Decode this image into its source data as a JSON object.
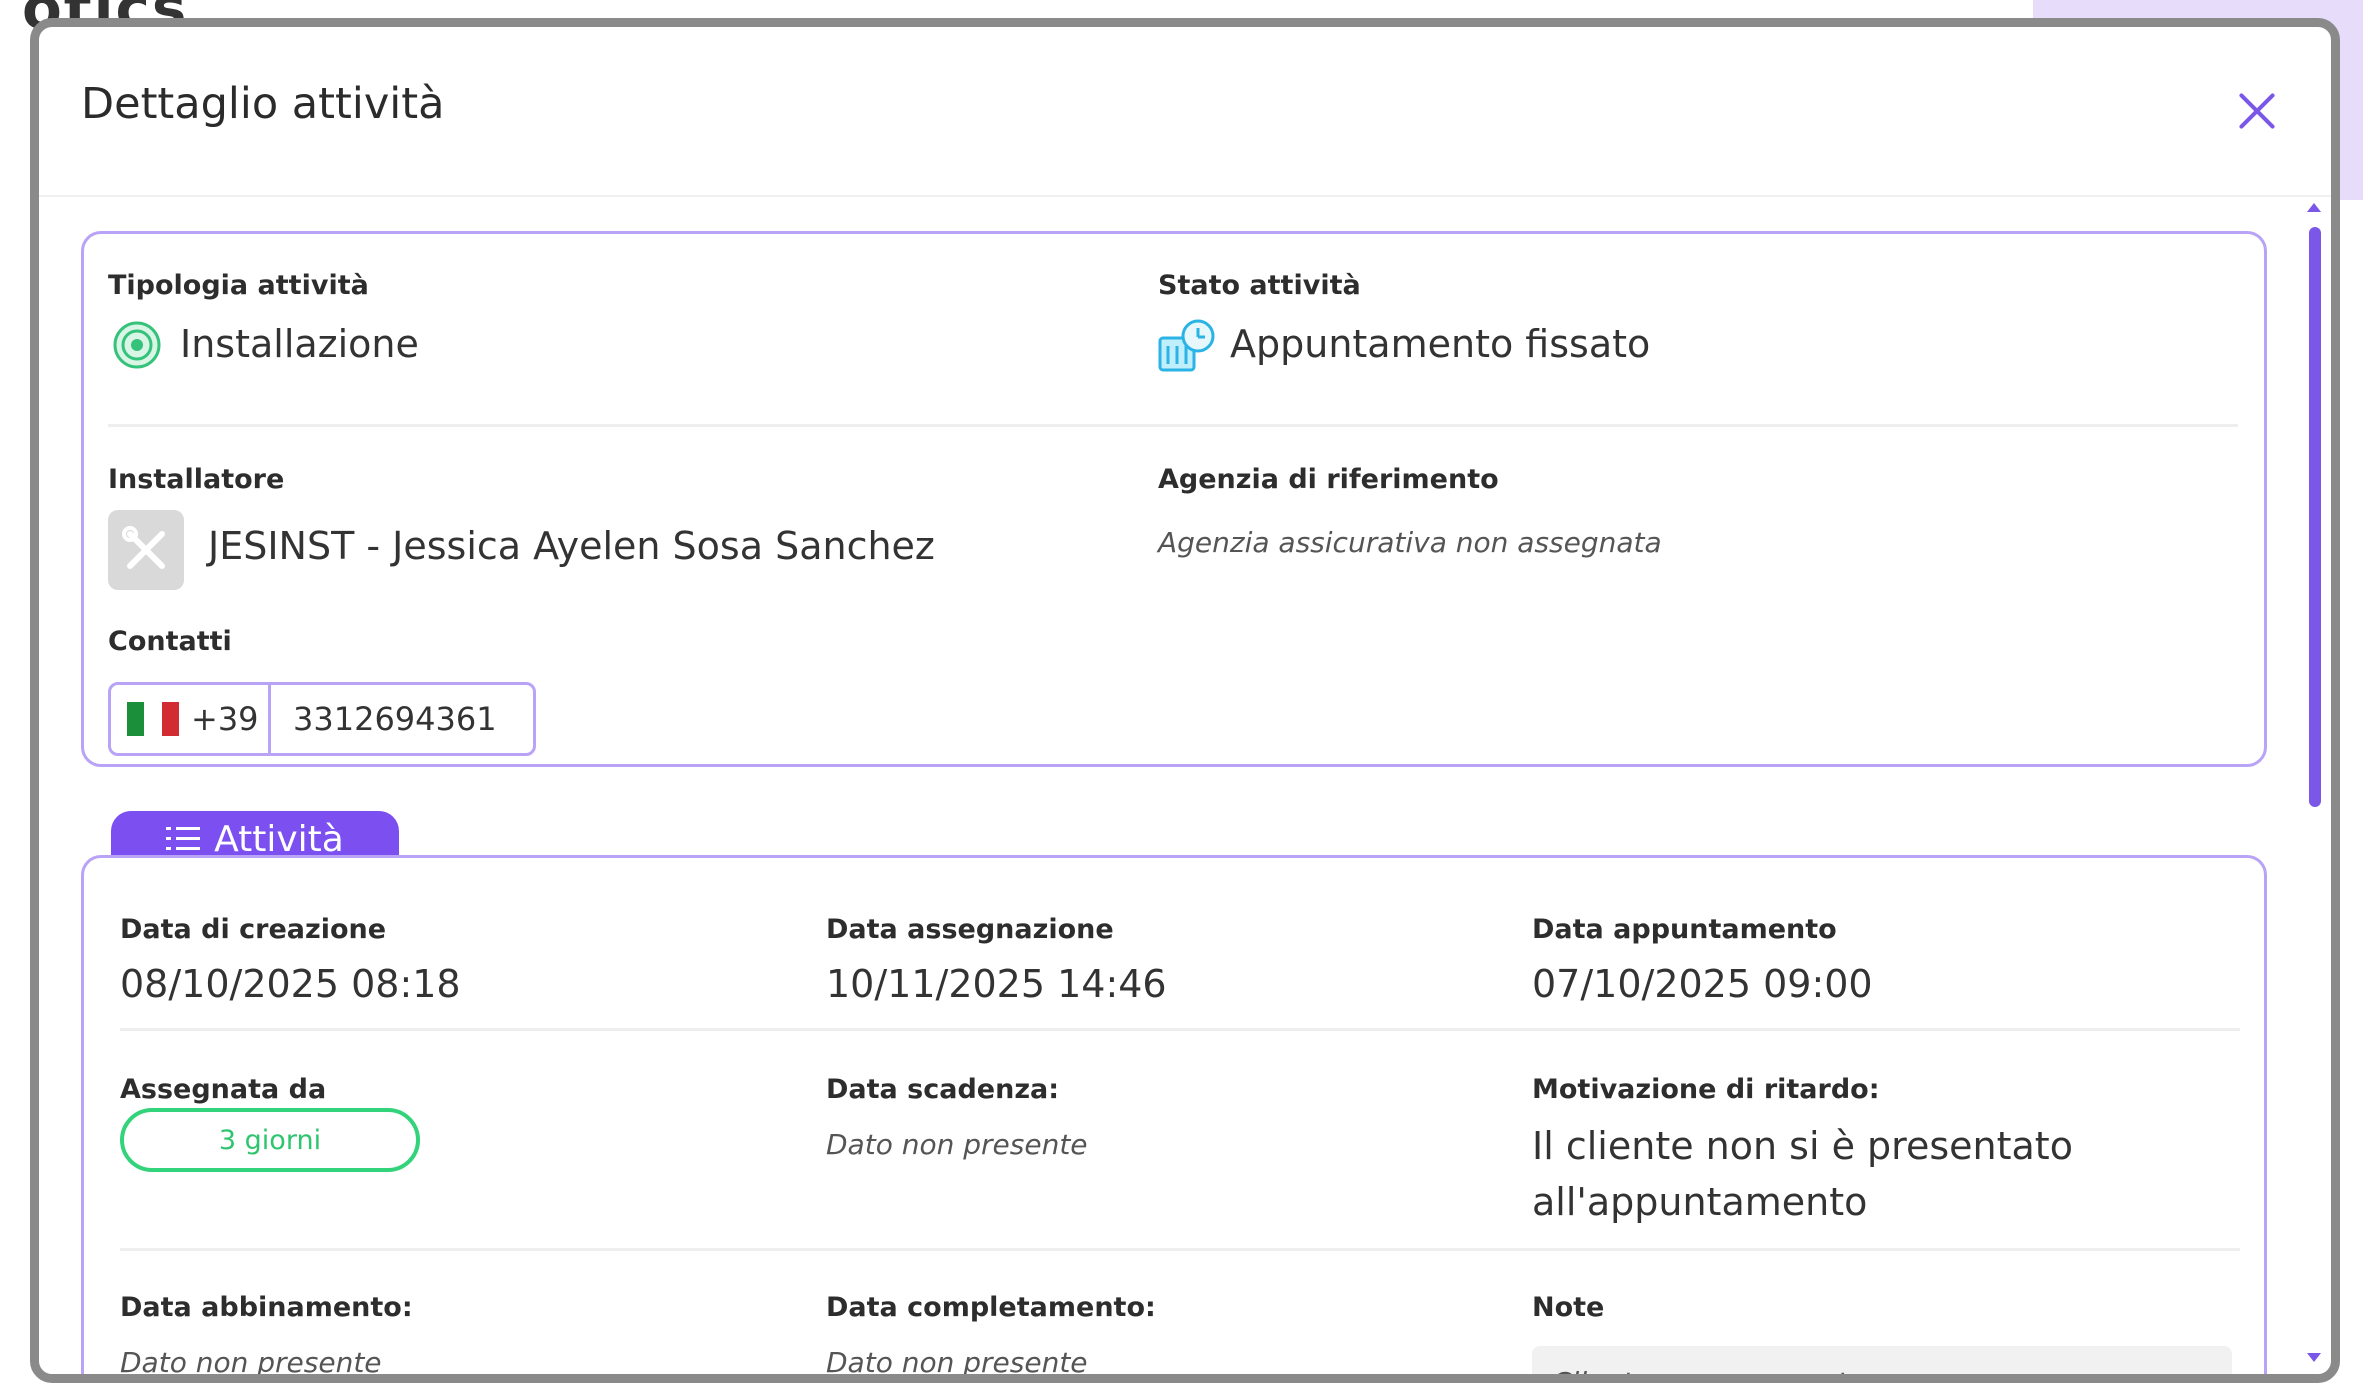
{
  "background": {
    "heading": "otics"
  },
  "modal": {
    "title": "Dettaglio attività",
    "close_label": "×"
  },
  "summary": {
    "tipologia_label": "Tipologia attività",
    "tipologia_value": "Installazione",
    "stato_label": "Stato attività",
    "stato_value": "Appuntamento fissato",
    "installatore_label": "Installatore",
    "installatore_value": "JESINST - Jessica Ayelen Sosa Sanchez",
    "agenzia_label": "Agenzia di riferimento",
    "agenzia_value": "Agenzia assicurativa non assegnata",
    "contatti_label": "Contatti",
    "phone_prefix": "+39",
    "phone_number": "3312694361"
  },
  "activity_tab": {
    "label": "Attività"
  },
  "activity": {
    "creazione_label": "Data di creazione",
    "creazione_value": "08/10/2025 08:18",
    "assegnazione_label": "Data assegnazione",
    "assegnazione_value": "10/11/2025 14:46",
    "appuntamento_label": "Data appuntamento",
    "appuntamento_value": "07/10/2025 09:00",
    "assegnata_label": "Assegnata da",
    "assegnata_value": "3 giorni",
    "scadenza_label": "Data scadenza:",
    "scadenza_value": "Dato non presente",
    "motivazione_label": "Motivazione di ritardo:",
    "motivazione_value_line1": "Il cliente non si è presentato",
    "motivazione_value_line2": "all'appuntamento",
    "abbinamento_label": "Data abbinamento:",
    "abbinamento_value": "Dato non presente",
    "completamento_label": "Data completamento:",
    "completamento_value": "Dato non presente",
    "note_label": "Note",
    "note_value": "Cliente non pervenuto"
  },
  "colors": {
    "accent": "#7b4ff0",
    "border": "#b9a3f6",
    "pill": "#33d37b"
  }
}
